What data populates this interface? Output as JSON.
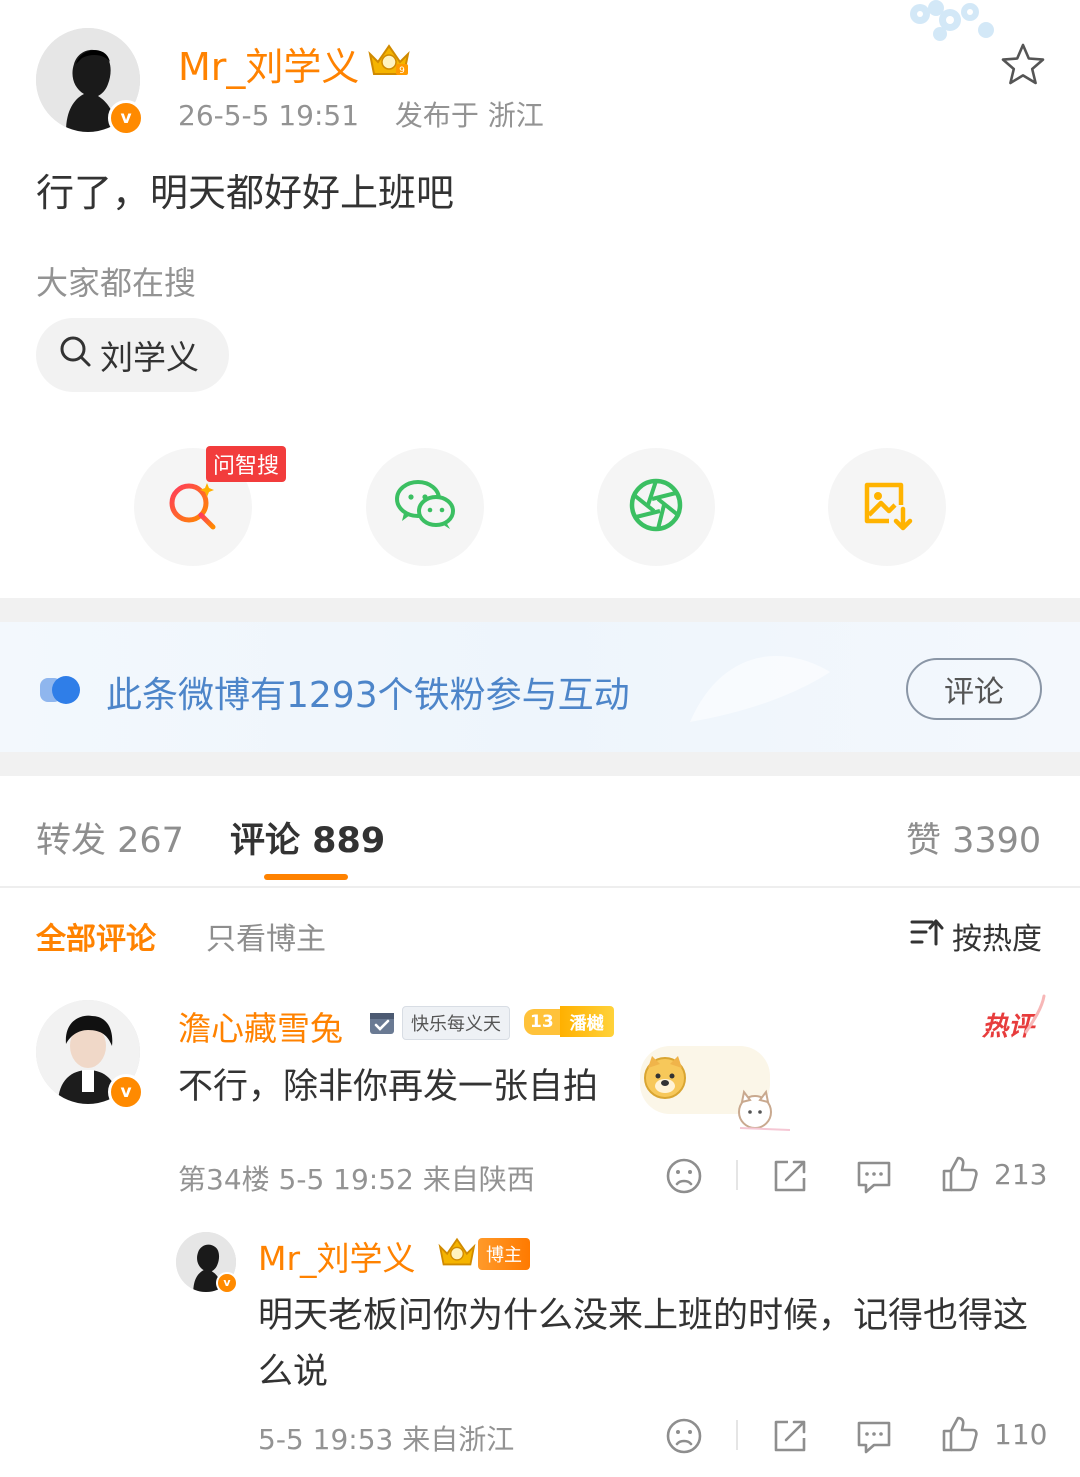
{
  "post": {
    "author": "Mr_刘学义",
    "time": "26-5-5 19:51",
    "location": "发布于 浙江",
    "text": "行了，明天都好好上班吧"
  },
  "trending": {
    "label": "大家都在搜",
    "query": "刘学义"
  },
  "share_actions": {
    "wenzhisou_badge": "问智搜",
    "icons": [
      "wenzhisou-search-icon",
      "wechat-icon",
      "moments-icon",
      "save-image-icon"
    ]
  },
  "fans_banner": {
    "text": "此条微博有1293个铁粉参与互动",
    "button": "评论"
  },
  "tabs": {
    "repost": "转发 267",
    "comments": "评论 889",
    "likes": "赞 3390"
  },
  "filters": {
    "all": "全部评论",
    "author_only": "只看博主",
    "sort": "按热度"
  },
  "comments": [
    {
      "user": "澹心藏雪兔",
      "medal": "快乐每义天",
      "fan_level": "13",
      "fan_level_tag": "潘樾",
      "hot_tag": "热评",
      "text": "不行，除非你再发一张自拍",
      "meta": "第34楼 5-5 19:52 来自陕西",
      "likes": "213",
      "reply": {
        "user": "Mr_刘学义",
        "role_tag": "博主",
        "text": "明天老板问你为什么没来上班的时候，记得也得这么说",
        "meta": "5-5 19:53 来自浙江",
        "likes": "110"
      }
    }
  ],
  "colors": {
    "accent": "#ff8200",
    "link_blue": "#4d85c9",
    "hot_red": "#e73c3c"
  }
}
